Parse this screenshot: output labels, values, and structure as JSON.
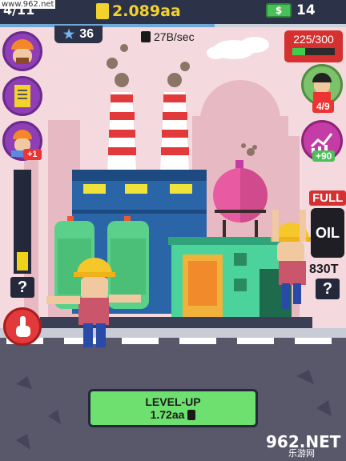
{
  "top_bar": {
    "level_progress": "4/11",
    "oil_total": "2.089aa",
    "cash_total": "14",
    "cash_symbol": "$",
    "level_progress_fraction": 0.62
  },
  "stars": {
    "value": "36"
  },
  "production": {
    "rate": "27B/sec"
  },
  "left_panel": {
    "worker_bonus": "+1",
    "boost_level_fraction": 0.18,
    "boost_help": "?"
  },
  "right_panel": {
    "energy": "225/300",
    "energy_fraction": 0.3,
    "operators": "4/9",
    "stats_gain": "+90",
    "storage_status": "FULL",
    "barrel_label": "OIL",
    "storage_amount": "830T",
    "storage_help": "?"
  },
  "level_up": {
    "title": "LEVEL-UP",
    "cost": "1.72aa"
  },
  "watermark": {
    "site_url": "www.962.net",
    "logo_text": "962.NET",
    "logo_sub": "乐游网"
  },
  "colors": {
    "sky": "#f4d9df",
    "topbar": "#2c3247",
    "accent_yellow": "#f3d22e",
    "levelup_green": "#6ee06f",
    "alert_red": "#d63131"
  }
}
